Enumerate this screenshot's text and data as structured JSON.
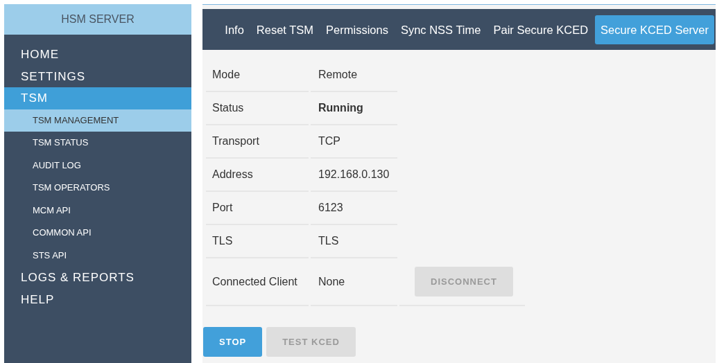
{
  "sidebar": {
    "title": "HSM SERVER",
    "items": [
      {
        "label": "HOME",
        "selected": false
      },
      {
        "label": "SETTINGS",
        "selected": false
      },
      {
        "label": "TSM",
        "selected": true,
        "children": [
          {
            "label": "TSM MANAGEMENT",
            "selected": true
          },
          {
            "label": "TSM STATUS",
            "selected": false
          },
          {
            "label": "AUDIT LOG",
            "selected": false
          },
          {
            "label": "TSM OPERATORS",
            "selected": false
          },
          {
            "label": "MCM API",
            "selected": false
          },
          {
            "label": "COMMON API",
            "selected": false
          },
          {
            "label": "STS API",
            "selected": false
          }
        ]
      },
      {
        "label": "LOGS & REPORTS",
        "selected": false
      },
      {
        "label": "HELP",
        "selected": false
      }
    ]
  },
  "tabs": [
    {
      "label": "Info",
      "selected": false
    },
    {
      "label": "Reset TSM",
      "selected": false
    },
    {
      "label": "Permissions",
      "selected": false
    },
    {
      "label": "Sync NSS Time",
      "selected": false
    },
    {
      "label": "Pair Secure KCED",
      "selected": false
    },
    {
      "label": "Secure KCED Server",
      "selected": true
    }
  ],
  "table": {
    "rows": [
      {
        "label": "Mode",
        "value": "Remote",
        "bold": false
      },
      {
        "label": "Status",
        "value": "Running",
        "bold": true
      },
      {
        "label": "Transport",
        "value": "TCP",
        "bold": false
      },
      {
        "label": "Address",
        "value": "192.168.0.130",
        "bold": false
      },
      {
        "label": "Port",
        "value": "6123",
        "bold": false
      },
      {
        "label": "TLS",
        "value": "TLS",
        "bold": false
      },
      {
        "label": "Connected Client",
        "value": "None",
        "bold": false,
        "action": {
          "label": "DISCONNECT",
          "disabled": true
        }
      }
    ]
  },
  "buttons": [
    {
      "label": "STOP",
      "disabled": false
    },
    {
      "label": "TEST KCED",
      "disabled": true
    }
  ]
}
